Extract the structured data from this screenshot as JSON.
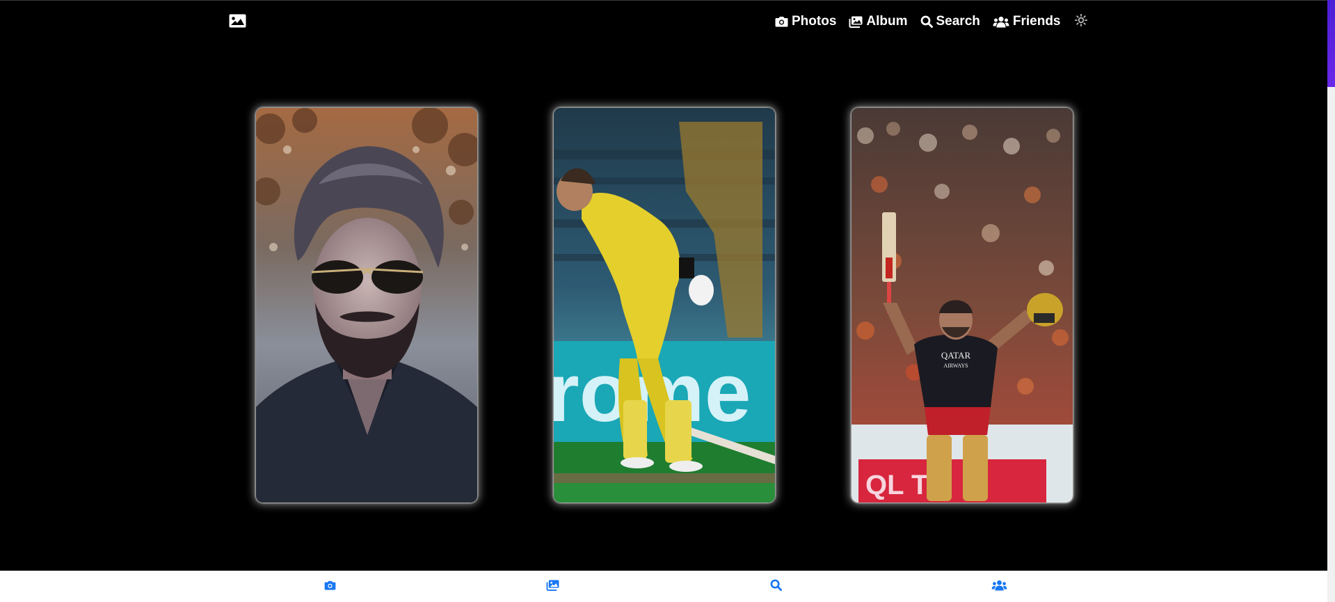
{
  "header": {
    "logo_icon": "image-icon",
    "nav": [
      {
        "label": "Photos",
        "icon": "camera-icon"
      },
      {
        "label": "Album",
        "icon": "images-icon"
      },
      {
        "label": "Search",
        "icon": "search-icon"
      },
      {
        "label": "Friends",
        "icon": "users-icon"
      }
    ],
    "theme_icon": "sun-icon"
  },
  "gallery": {
    "photos": [
      {
        "subject": "portrait"
      },
      {
        "subject": "cricket-batsman-yellow"
      },
      {
        "subject": "cricket-batsman-celebration"
      }
    ]
  },
  "bottom_nav": [
    {
      "icon": "camera-icon"
    },
    {
      "icon": "images-icon"
    },
    {
      "icon": "search-icon"
    },
    {
      "icon": "users-icon"
    }
  ],
  "colors": {
    "accent": "#1877f2",
    "background": "#000000",
    "scroll_thumb": "#5a22e0"
  }
}
